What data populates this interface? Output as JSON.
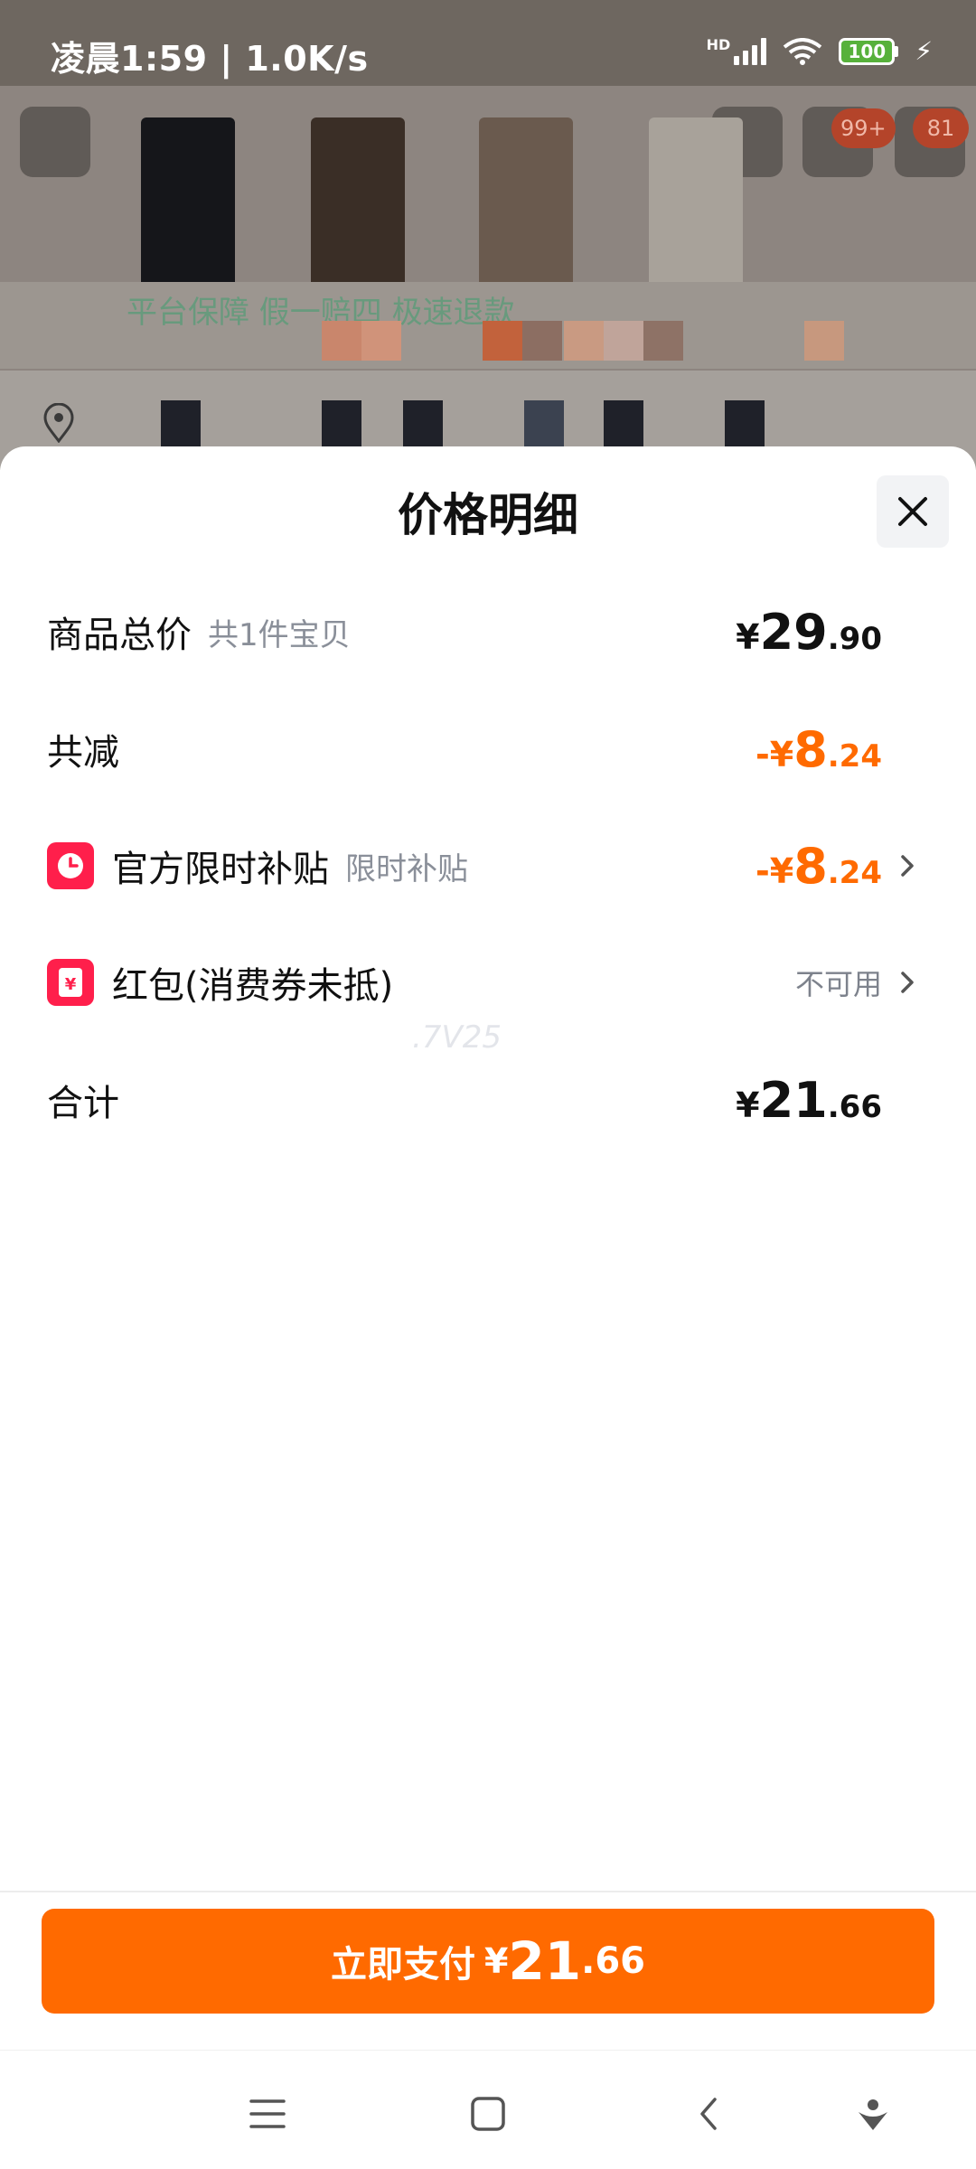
{
  "status_bar": {
    "time_speed": "凌晨1:59 | 1.0K/s",
    "signal_label": "HD",
    "battery": "100"
  },
  "background": {
    "cart_badge": "99+",
    "msg_badge": "81",
    "guarantee_text": "平台保障 假一赔四 极速退款"
  },
  "sheet": {
    "title": "价格明细",
    "rows": [
      {
        "label": "商品总价",
        "sub": "共1件宝贝",
        "price_symbol": "¥",
        "price_int": "29",
        "price_dec": ".90"
      },
      {
        "label": "共减",
        "price_symbol": "-¥",
        "price_int": "8",
        "price_dec": ".24"
      },
      {
        "label": "官方限时补贴",
        "sub": "限时补贴",
        "price_symbol": "-¥",
        "price_int": "8",
        "price_dec": ".24"
      },
      {
        "label": "红包(消费券未抵)",
        "status": "不可用"
      },
      {
        "label": "合计",
        "price_symbol": "¥",
        "price_int": "21",
        "price_dec": ".66"
      }
    ],
    "watermark": ".7V25"
  },
  "pay_button": {
    "label": "立即支付",
    "price_symbol": "¥",
    "price_int": "21",
    "price_dec": ".66"
  },
  "colors": {
    "accent": "#ff6a00",
    "icon_red": "#ff1f4b",
    "text_primary": "#111111",
    "text_secondary": "#8a8f99"
  },
  "icons": {
    "close": "close-icon",
    "clock": "clock-icon",
    "red_packet": "red-packet-icon",
    "chevron": "chevron-right-icon",
    "nav_menu": "menu-icon",
    "nav_home": "home-icon",
    "nav_back": "back-icon",
    "nav_assistant": "assistant-icon"
  }
}
